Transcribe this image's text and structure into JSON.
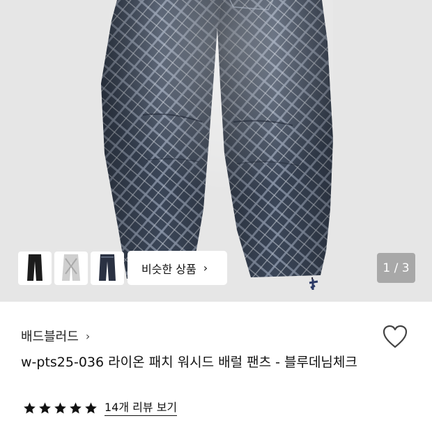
{
  "gallery": {
    "similar_label": "비슷한 상품",
    "similar_chevron": "›",
    "counter": "1 / 3",
    "thumbnails": [
      {
        "name": "thumb-black-pants"
      },
      {
        "name": "thumb-white-pants"
      },
      {
        "name": "thumb-navy-pants"
      }
    ]
  },
  "product": {
    "brand": "배드블러드",
    "brand_chevron": "›",
    "title": "w-pts25-036 라이온 패치 워시드 배럴 팬츠 - 블루데님체크",
    "rating_stars": 5,
    "reviews_label": "14개 리뷰 보기"
  },
  "colors": {
    "hero_bg": "#e6e6e6",
    "denim": "#3b4658",
    "plaid_line": "#9aa4b4",
    "star": "#111111"
  },
  "icons": {
    "heart": "heart-outline-icon",
    "star": "star-filled-icon",
    "chevron": "chevron-right-icon"
  }
}
